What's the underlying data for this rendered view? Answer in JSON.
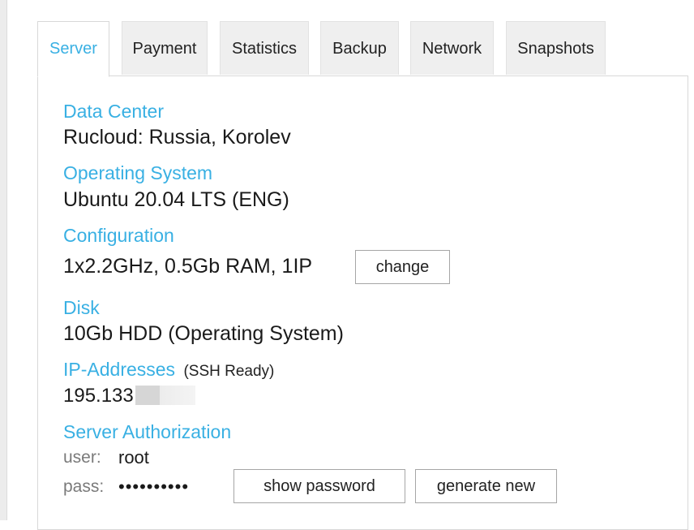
{
  "tabs": [
    {
      "label": "Server",
      "active": true
    },
    {
      "label": "Payment",
      "active": false
    },
    {
      "label": "Statistics",
      "active": false
    },
    {
      "label": "Backup",
      "active": false
    },
    {
      "label": "Network",
      "active": false
    },
    {
      "label": "Snapshots",
      "active": false
    }
  ],
  "server": {
    "data_center": {
      "title": "Data Center",
      "value": "Rucloud: Russia, Korolev"
    },
    "os": {
      "title": "Operating System",
      "value": "Ubuntu 20.04 LTS (ENG)"
    },
    "configuration": {
      "title": "Configuration",
      "value": "1x2.2GHz, 0.5Gb RAM, 1IP",
      "change_label": "change"
    },
    "disk": {
      "title": "Disk",
      "value": "10Gb HDD (Operating System)"
    },
    "ip": {
      "title": "IP-Addresses",
      "note": "(SSH Ready)",
      "value": "195.133"
    },
    "auth": {
      "title": "Server Authorization",
      "user_label": "user:",
      "user_value": "root",
      "pass_label": "pass:",
      "pass_value": "••••••••••",
      "show_password_label": "show password",
      "generate_new_label": "generate new"
    }
  },
  "colors": {
    "accent": "#39b0e3",
    "tab_bg": "#efefef",
    "border": "#d8d8d8"
  }
}
